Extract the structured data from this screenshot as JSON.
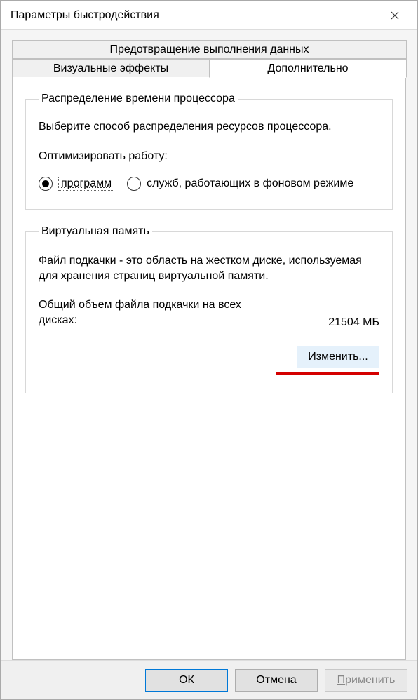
{
  "window": {
    "title": "Параметры быстродействия"
  },
  "tabs": {
    "dep": "Предотвращение выполнения данных",
    "visual": "Визуальные эффекты",
    "advanced": "Дополнительно"
  },
  "cpu_group": {
    "legend": "Распределение времени процессора",
    "desc": "Выберите способ распределения ресурсов процессора.",
    "optimize_label": "Оптимизировать работу:",
    "radio_programs": "программ",
    "radio_services": "служб, работающих в фоновом режиме"
  },
  "vm_group": {
    "legend": "Виртуальная память",
    "desc": "Файл подкачки - это область на жестком диске, используемая для хранения страниц виртуальной памяти.",
    "total_label": "Общий объем файла подкачки на всех дисках:",
    "total_value": "21504 МБ",
    "change_button": "Изменить..."
  },
  "buttons": {
    "ok": "ОК",
    "cancel": "Отмена",
    "apply": "Применить"
  }
}
